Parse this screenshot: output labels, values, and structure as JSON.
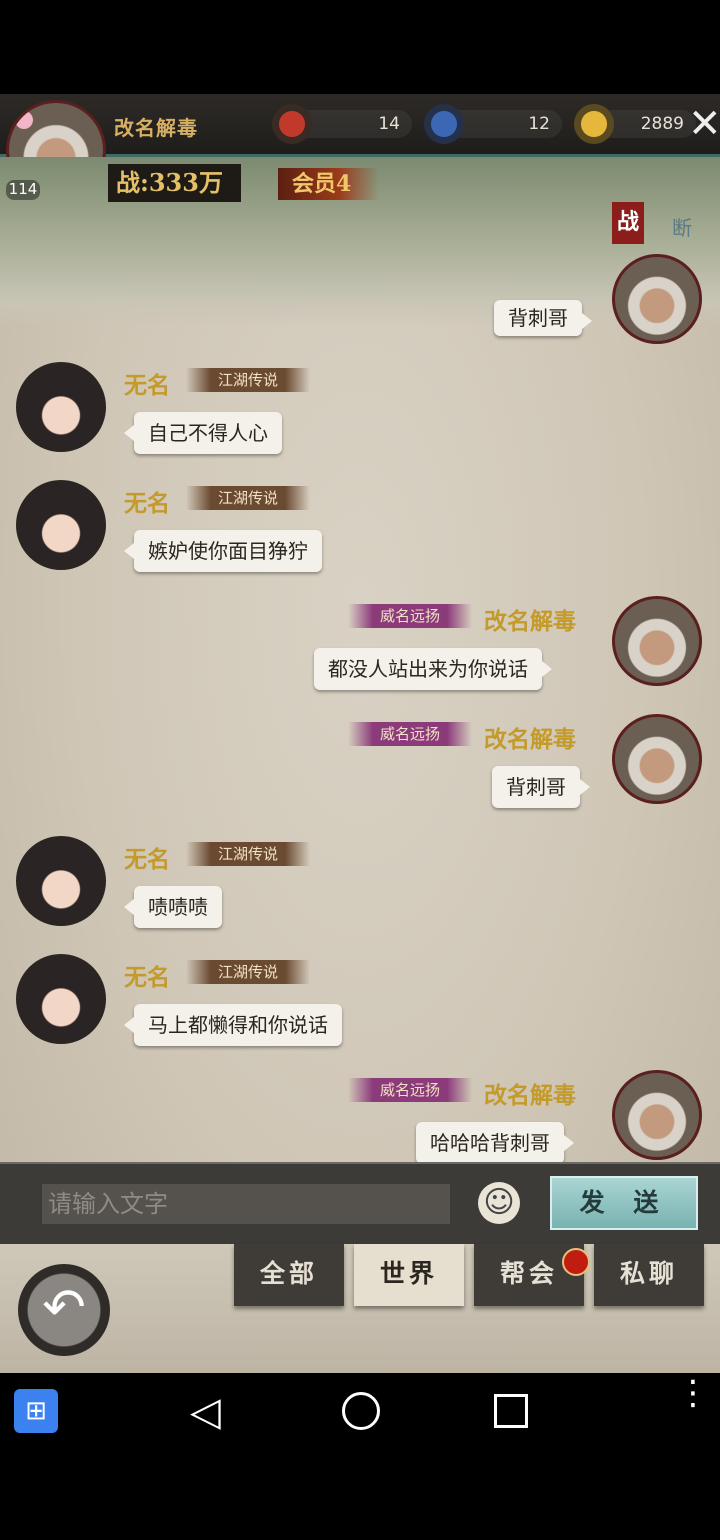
{
  "header": {
    "player_name": "改名解毒",
    "level": "114",
    "resources": [
      {
        "icon": "red-scroll-icon",
        "value": "14"
      },
      {
        "icon": "blue-scroll-icon",
        "value": "12"
      },
      {
        "icon": "gold-ingot-icon",
        "value": "2889"
      }
    ],
    "power": "战:333万",
    "vip": "会员4",
    "map_tag": "战",
    "map_tag2": "断"
  },
  "messages": [
    {
      "side": "right",
      "name": "",
      "badge": "",
      "text": "背刺哥",
      "partial": true
    },
    {
      "side": "left",
      "name": "无名",
      "badge": "江湖传说",
      "text": "自己不得人心"
    },
    {
      "side": "left",
      "name": "无名",
      "badge": "江湖传说",
      "text": "嫉妒使你面目狰狞"
    },
    {
      "side": "right",
      "name": "改名解毒",
      "badge": "威名远扬",
      "text": "都没人站出来为你说话"
    },
    {
      "side": "right",
      "name": "改名解毒",
      "badge": "威名远扬",
      "text": "背刺哥"
    },
    {
      "side": "left",
      "name": "无名",
      "badge": "江湖传说",
      "text": "啧啧啧"
    },
    {
      "side": "left",
      "name": "无名",
      "badge": "江湖传说",
      "text": "马上都懒得和你说话"
    },
    {
      "side": "right",
      "name": "改名解毒",
      "badge": "威名远扬",
      "text": "哈哈哈背刺哥"
    }
  ],
  "input": {
    "placeholder": "请输入文字",
    "send_label": "发 送",
    "emoji": "☺"
  },
  "tabs": [
    {
      "label": "全部",
      "active": false
    },
    {
      "label": "世界",
      "active": true
    },
    {
      "label": "帮会",
      "active": false,
      "notification": true
    },
    {
      "label": "私聊",
      "active": false
    }
  ],
  "back_icon": "↶",
  "colors": {
    "name_gold": "#c49a2a",
    "send_teal": "#8fc4c3",
    "badge_purple": "#8c3b7a"
  }
}
